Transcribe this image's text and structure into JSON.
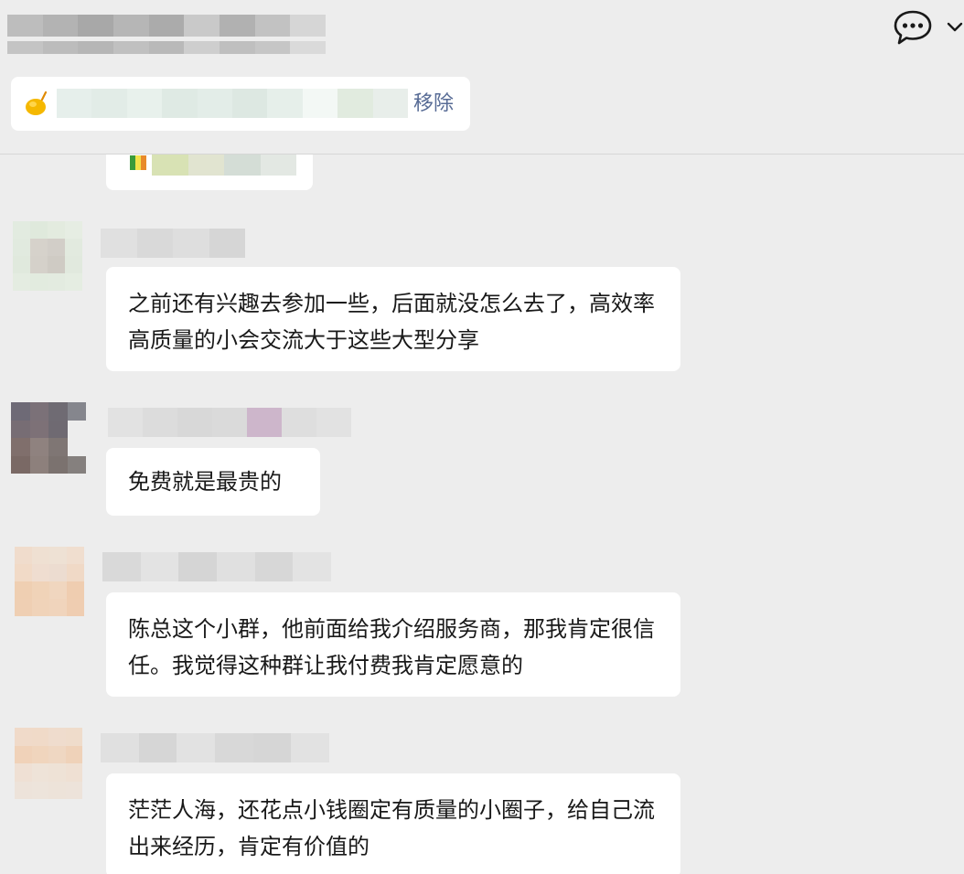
{
  "header": {
    "chat_icon": "chat-bubble-dots-icon",
    "chevron_icon": "chevron-down-icon",
    "colors": {
      "background": "#ededed",
      "link": "#576b95"
    }
  },
  "pinned": {
    "icon": "lemon-icon",
    "remove_label": "移除"
  },
  "messages": [
    {
      "text": "之前还有兴趣去参加一些，后面就没怎么去了，高效率高质量的小会交流大于这些大型分享"
    },
    {
      "text": "免费就是最贵的"
    },
    {
      "text": "陈总这个小群，他前面给我介绍服务商，那我肯定很信任。我觉得这种群让我付费我肯定愿意的"
    },
    {
      "text": "茫茫人海，还花点小钱圈定有质量的小圈子，给自己流出来经历，肯定有价值的"
    }
  ]
}
